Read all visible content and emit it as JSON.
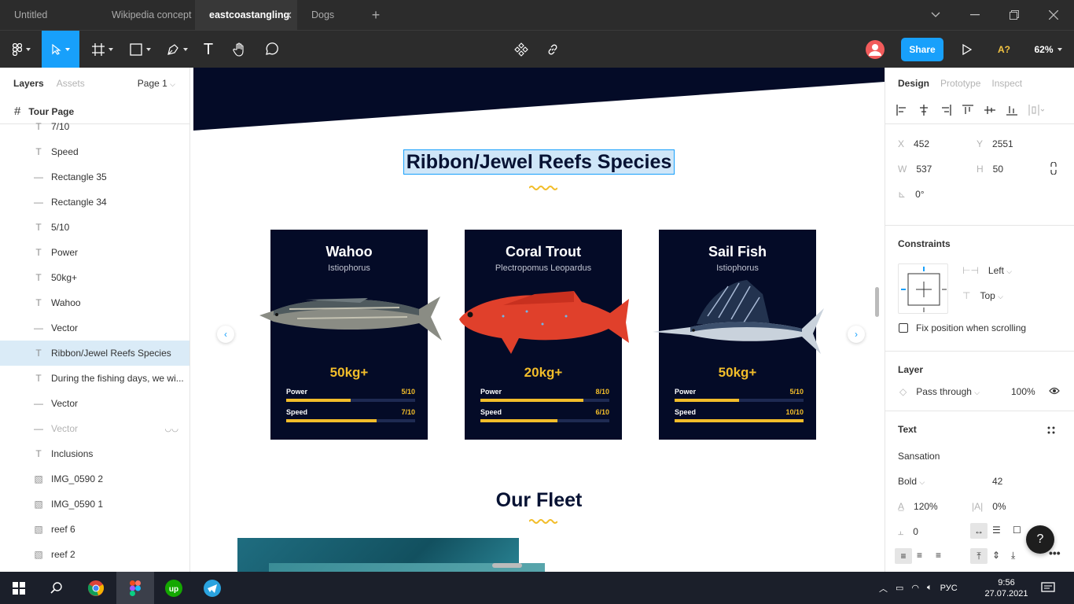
{
  "tabs": [
    {
      "label": "Untitled"
    },
    {
      "label": "Wikipedia concept"
    },
    {
      "label": "eastcoastangling"
    },
    {
      "label": "Dogs"
    }
  ],
  "toolbar": {
    "share_label": "Share",
    "zoom": "62%",
    "assist": "A?"
  },
  "left_panel": {
    "tab_layers": "Layers",
    "tab_assets": "Assets",
    "page_selector": "Page 1",
    "page_name": "Tour Page",
    "layers": [
      {
        "icon": "T",
        "label": "7/10"
      },
      {
        "icon": "T",
        "label": "Speed"
      },
      {
        "icon": "—",
        "label": "Rectangle 35"
      },
      {
        "icon": "—",
        "label": "Rectangle 34"
      },
      {
        "icon": "T",
        "label": "5/10"
      },
      {
        "icon": "T",
        "label": "Power"
      },
      {
        "icon": "T",
        "label": "50kg+"
      },
      {
        "icon": "T",
        "label": "Wahoo"
      },
      {
        "icon": "—",
        "label": "Vector"
      },
      {
        "icon": "T",
        "label": "Ribbon/Jewel Reefs Species"
      },
      {
        "icon": "T",
        "label": "During the fishing days, we wi..."
      },
      {
        "icon": "—",
        "label": "Vector"
      },
      {
        "icon": "—",
        "label": "Vector"
      },
      {
        "icon": "T",
        "label": "Inclusions"
      },
      {
        "icon": "▧",
        "label": "IMG_0590 2"
      },
      {
        "icon": "▧",
        "label": "IMG_0590 1"
      },
      {
        "icon": "▧",
        "label": "reef 6"
      },
      {
        "icon": "▧",
        "label": "reef 2"
      }
    ]
  },
  "canvas": {
    "section_title": "Ribbon/Jewel Reefs Species",
    "fleet_title": "Our Fleet",
    "cards": [
      {
        "name": "Wahoo",
        "sci": "Istiophorus",
        "weight": "50kg+",
        "power_label": "Power",
        "power_value": "5/10",
        "power_fraction": 0.5,
        "speed_label": "Speed",
        "speed_value": "7/10",
        "speed_fraction": 0.7
      },
      {
        "name": "Coral Trout",
        "sci": "Plectropomus Leopardus",
        "weight": "20kg+",
        "power_label": "Power",
        "power_value": "8/10",
        "power_fraction": 0.8,
        "speed_label": "Speed",
        "speed_value": "6/10",
        "speed_fraction": 0.6
      },
      {
        "name": "Sail Fish",
        "sci": "Istiophorus",
        "weight": "50kg+",
        "power_label": "Power",
        "power_value": "5/10",
        "power_fraction": 0.5,
        "speed_label": "Speed",
        "speed_value": "10/10",
        "speed_fraction": 1.0
      }
    ]
  },
  "right_panel": {
    "tab_design": "Design",
    "tab_prototype": "Prototype",
    "tab_inspect": "Inspect",
    "x_label": "X",
    "x_value": "452",
    "y_label": "Y",
    "y_value": "2551",
    "w_label": "W",
    "w_value": "537",
    "h_label": "H",
    "h_value": "50",
    "rotation": "0°",
    "constraints_title": "Constraints",
    "constraint_h": "Left",
    "constraint_v": "Top",
    "fix_position": "Fix position when scrolling",
    "layer_title": "Layer",
    "blend_mode": "Pass through",
    "opacity": "100%",
    "text_title": "Text",
    "font_family": "Sansation",
    "font_weight": "Bold",
    "font_size": "42",
    "line_height": "120%",
    "letter_spacing": "0%",
    "paragraph_spacing": "0"
  },
  "taskbar": {
    "lang": "РУС",
    "time": "9:56",
    "date": "27.07.2021"
  },
  "colors": {
    "accent": "#18a0fb",
    "card_bg": "#040b27",
    "highlight": "#f2bd2a",
    "title": "#071233"
  }
}
